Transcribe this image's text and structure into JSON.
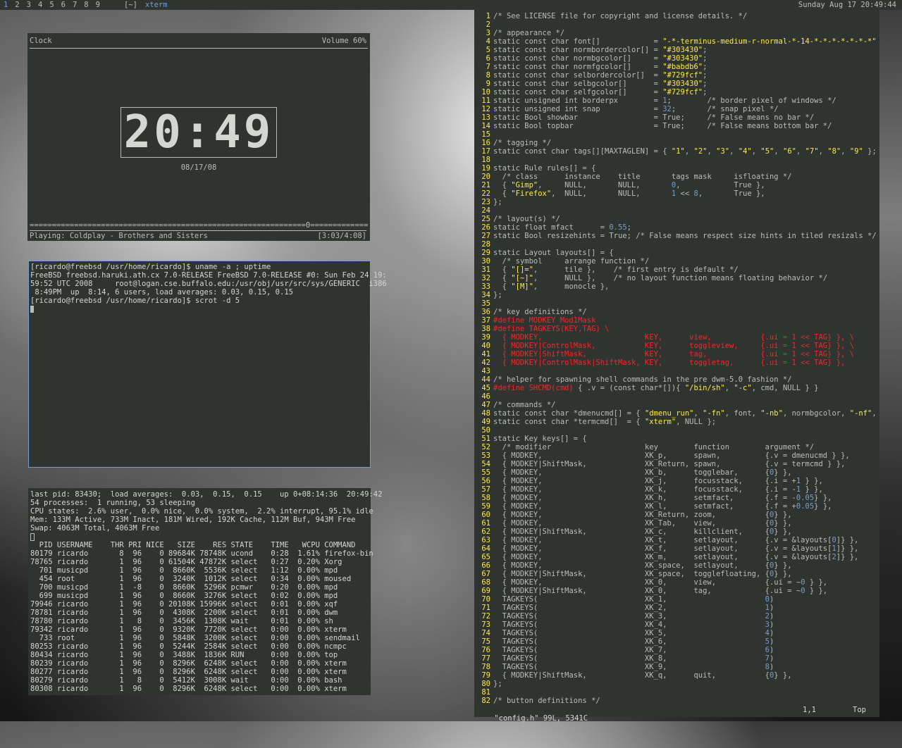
{
  "topbar": {
    "tags": [
      "1",
      "2",
      "3",
      "4",
      "5",
      "6",
      "7",
      "8",
      "9"
    ],
    "layout": "[~]",
    "window_title": "xterm",
    "datetime": "Sunday Aug 17 20:49:44"
  },
  "clock": {
    "title": "Clock",
    "volume": "Volume 60%",
    "time": "20:49",
    "date": "08/17/08",
    "progress": "==============================================================0======================",
    "playing": "Playing: Coldplay - Brothers and Sisters",
    "elapsed": "[3:03/4:08]"
  },
  "xterm1": {
    "lines": [
      "[ricardo@freebsd /usr/home/ricardo]$ uname -a ; uptime",
      "FreeBSD freebsd.haruki.ath.cx 7.0-RELEASE FreeBSD 7.0-RELEASE #0: Sun Feb 24 19:",
      "59:52 UTC 2008     root@logan.cse.buffalo.edu:/usr/obj/usr/src/sys/GENERIC  i386",
      " 8:49PM  up  8:14, 6 users, load averages: 0.03, 0.15, 0.15",
      "[ricardo@freebsd /usr/home/ricardo]$ scrot -d 5"
    ]
  },
  "top": {
    "header": [
      "last pid: 83430;  load averages:  0.03,  0.15,  0.15    up 0+08:14:36  20:49:42",
      "54 processes:  1 running, 53 sleeping",
      "CPU states:  2.6% user,  0.0% nice,  0.0% system,  2.2% interrupt, 95.1% idle",
      "Mem: 133M Active, 733M Inact, 181M Wired, 192K Cache, 112M Buf, 943M Free",
      "Swap: 4063M Total, 4063M Free"
    ],
    "columns": "  PID USERNAME    THR PRI NICE   SIZE    RES STATE    TIME   WCPU COMMAND",
    "rows": [
      "80179 ricardo       8  96    0 89684K 78748K ucond    0:28  1.61% firefox-bin",
      "78765 ricardo       1  96    0 61504K 47872K select   0:27  0.20% Xorg",
      "  701 musicpd       1  96    0  8660K  5536K select   1:12  0.00% mpd",
      "  454 root          1  96    0  3240K  1012K select   0:34  0.00% moused",
      "  700 musicpd       1  -8    0  8660K  5296K pcmwr    0:20  0.00% mpd",
      "  699 musicpd       1  96    0  8660K  3276K select   0:02  0.00% mpd",
      "79946 ricardo       1  96    0 20108K 15996K select   0:01  0.00% xqf",
      "78781 ricardo       1  96    0  4308K  2200K select   0:01  0.00% dwm",
      "78780 ricardo       1   8    0  3456K  1308K wait     0:01  0.00% sh",
      "79342 ricardo       1  96    0  9320K  7720K select   0:00  0.00% xterm",
      "  733 root          1  96    0  5848K  3200K select   0:00  0.00% sendmail",
      "80253 ricardo       1  96    0  5244K  2584K select   0:00  0.00% ncmpc",
      "80434 ricardo       1  96    0  3488K  1836K RUN      0:00  0.00% top",
      "80239 ricardo       1  96    0  8296K  6248K select   0:00  0.00% xterm",
      "80277 ricardo       1  96    0  8296K  6248K select   0:00  0.00% xterm",
      "80279 ricardo       1   8    0  5412K  3008K wait     0:00  0.00% bash",
      "80308 ricardo       1  96    0  8296K  6248K select   0:00  0.00% xterm"
    ]
  },
  "vim": {
    "lines": [
      "/* See LICENSE file for copyright and license details. */",
      "",
      "/* appearance */",
      "static const char font[]            = \"-*-terminus-medium-r-normal-*-14-*-*-*-*-*-*-*\";",
      "static const char normbordercolor[] = \"#303430\";",
      "static const char normbgcolor[]     = \"#303430\";",
      "static const char normfgcolor[]     = \"#babdb6\";",
      "static const char selbordercolor[]  = \"#729fcf\";",
      "static const char selbgcolor[]      = \"#303430\";",
      "static const char selfgcolor[]      = \"#729fcf\";",
      "static unsigned int borderpx        = 1;        /* border pixel of windows */",
      "static unsigned int snap            = 32;       /* snap pixel */",
      "static Bool showbar                 = True;     /* False means no bar */",
      "static Bool topbar                  = True;     /* False means bottom bar */",
      "",
      "/* tagging */",
      "static const char tags[][MAXTAGLEN] = { \"1\", \"2\", \"3\", \"4\", \"5\", \"6\", \"7\", \"8\", \"9\" };",
      "",
      "static Rule rules[] = {",
      "  /* class      instance    title       tags mask     isfloating */",
      "  { \"Gimp\",     NULL,       NULL,       0,            True },",
      "  { \"Firefox\",  NULL,       NULL,       1 << 8,       True },",
      "};",
      "",
      "/* layout(s) */",
      "static float mfact      = 0.55;",
      "static Bool resizehints = True; /* False means respect size hints in tiled resizals */",
      "",
      "static Layout layouts[] = {",
      "  /* symbol     arrange function */",
      "  { \"[]=\",      tile },    /* first entry is default */",
      "  { \"[~]\",      NULL },    /* no layout function means floating behavior */",
      "  { \"[M]\",      monocle },",
      "};",
      "",
      "/* key definitions */",
      "#define MODKEY Mod1Mask",
      "#define TAGKEYS(KEY,TAG) \\",
      "  { MODKEY,                       KEY,      view,           {.ui = 1 << TAG} }, \\",
      "  { MODKEY|ControlMask,           KEY,      toggleview,     {.ui = 1 << TAG} }, \\",
      "  { MODKEY|ShiftMask,             KEY,      tag,            {.ui = 1 << TAG} }, \\",
      "  { MODKEY|ControlMask|ShiftMask, KEY,      toggletag,      {.ui = 1 << TAG} },",
      "",
      "/* helper for spawning shell commands in the pre dwm-5.0 fashion */",
      "#define SHCMD(cmd) { .v = (const char*[]){ \"/bin/sh\", \"-c\", cmd, NULL } }",
      "",
      "/* commands */",
      "static const char *dmenucmd[] = { \"dmenu_run\", \"-fn\", font, \"-nb\", normbgcolor, \"-nf\", norm",
      "static const char *termcmd[]  = { \"xterm\", NULL };",
      "",
      "static Key keys[] = {",
      "  /* modifier                     key        function        argument */",
      "  { MODKEY,                       XK_p,      spawn,          {.v = dmenucmd } },",
      "  { MODKEY|ShiftMask,             XK_Return, spawn,          {.v = termcmd } },",
      "  { MODKEY,                       XK_b,      togglebar,      {0} },",
      "  { MODKEY,                       XK_j,      focusstack,     {.i = +1 } },",
      "  { MODKEY,                       XK_k,      focusstack,     {.i = -1 } },",
      "  { MODKEY,                       XK_h,      setmfact,       {.f = -0.05} },",
      "  { MODKEY,                       XK_l,      setmfact,       {.f = +0.05} },",
      "  { MODKEY,                       XK_Return, zoom,           {0} },",
      "  { MODKEY,                       XK_Tab,    view,           {0} },",
      "  { MODKEY|ShiftMask,             XK_c,      killclient,     {0} },",
      "  { MODKEY,                       XK_t,      setlayout,      {.v = &layouts[0]} },",
      "  { MODKEY,                       XK_f,      setlayout,      {.v = &layouts[1]} },",
      "  { MODKEY,                       XK_m,      setlayout,      {.v = &layouts[2]} },",
      "  { MODKEY,                       XK_space,  setlayout,      {0} },",
      "  { MODKEY|ShiftMask,             XK_space,  togglefloating, {0} },",
      "  { MODKEY,                       XK_0,      view,           {.ui = ~0 } },",
      "  { MODKEY|ShiftMask,             XK_0,      tag,            {.ui = ~0 } },",
      "  TAGKEYS(                        XK_1,                      0)",
      "  TAGKEYS(                        XK_2,                      1)",
      "  TAGKEYS(                        XK_3,                      2)",
      "  TAGKEYS(                        XK_4,                      3)",
      "  TAGKEYS(                        XK_5,                      4)",
      "  TAGKEYS(                        XK_6,                      5)",
      "  TAGKEYS(                        XK_7,                      6)",
      "  TAGKEYS(                        XK_8,                      7)",
      "  TAGKEYS(                        XK_9,                      8)",
      "  { MODKEY|ShiftMask,             XK_q,      quit,           {0} },",
      "};",
      "",
      "/* button definitions */"
    ],
    "status_file": "\"config.h\" 99L, 5341C",
    "status_pos": "1,1",
    "status_scroll": "Top"
  }
}
